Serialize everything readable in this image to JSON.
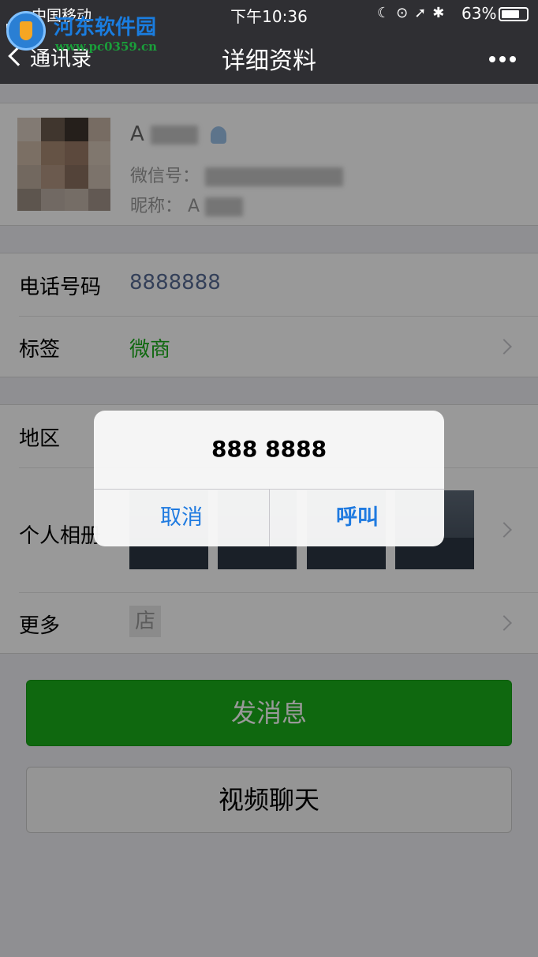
{
  "status_bar": {
    "carrier": "中国移动",
    "time": "下午10:36",
    "battery": "63%"
  },
  "watermark": {
    "title": "河东软件园",
    "url": "www.pc0359.cn"
  },
  "nav": {
    "back_label": "通讯录",
    "title": "详细资料"
  },
  "profile": {
    "name_prefix": "A",
    "wxid_label": "微信号：",
    "alias_label": "昵称：",
    "alias_prefix": "A"
  },
  "info": {
    "phone_label": "电话号码",
    "phone_value": "8888888",
    "tag_label": "标签",
    "tag_value": "微商"
  },
  "details": {
    "region_label": "地区",
    "album_label": "个人相册",
    "more_label": "更多",
    "shop_glyph": "店"
  },
  "actions": {
    "message": "发消息",
    "video": "视频聊天"
  },
  "alert": {
    "message": "888 8888",
    "cancel": "取消",
    "call": "呼叫"
  },
  "colors": {
    "accent_green": "#1aad19",
    "tag_green": "#1aad19",
    "phone_blue": "#576b95",
    "ios_blue": "#1f7ae0",
    "nav_bg": "#2f2f33"
  }
}
